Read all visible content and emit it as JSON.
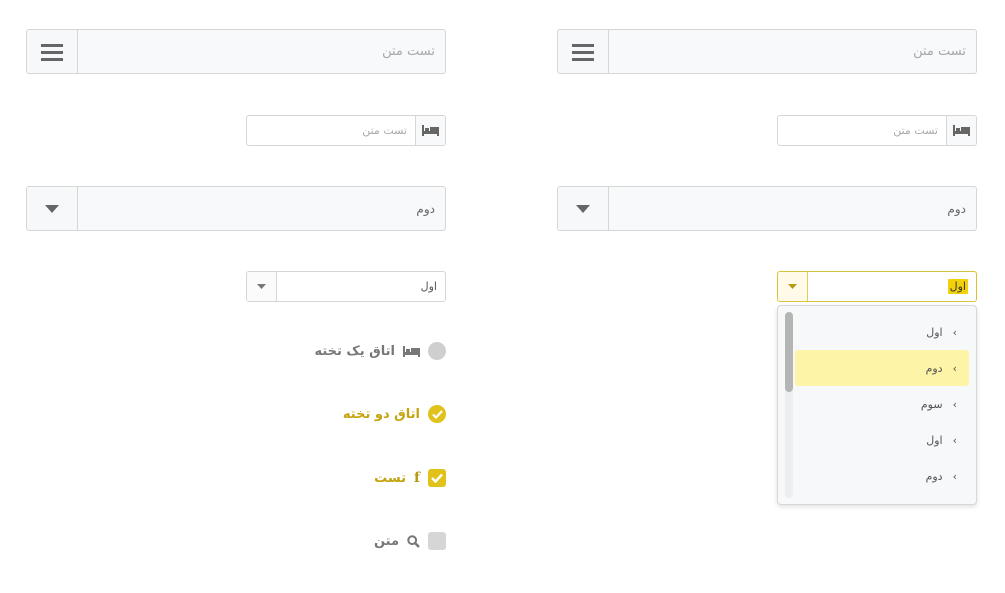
{
  "left_column": {
    "menu_field": {
      "placeholder": "تست متن"
    },
    "icon_field": {
      "placeholder": "تست متن"
    },
    "select_large": {
      "value": "دوم"
    },
    "select_small": {
      "value": "اول"
    },
    "options": [
      {
        "type": "radio",
        "state": "off",
        "icon": "bed-icon",
        "label": "اتاق یک تخته"
      },
      {
        "type": "radio",
        "state": "on",
        "icon": null,
        "label": "اتاق دو تخته"
      },
      {
        "type": "checkbox",
        "state": "on",
        "icon": "facebook-icon",
        "label": "تست"
      },
      {
        "type": "checkbox",
        "state": "off",
        "icon": "search-icon",
        "label": "متن"
      }
    ]
  },
  "right_column": {
    "menu_field": {
      "placeholder": "تست متن"
    },
    "icon_field": {
      "placeholder": "تست متن"
    },
    "select_large": {
      "value": "دوم"
    },
    "select_open": {
      "value": "اول",
      "items": [
        {
          "label": "اول",
          "selected": false
        },
        {
          "label": "دوم",
          "selected": true
        },
        {
          "label": "سوم",
          "selected": false
        },
        {
          "label": "اول",
          "selected": false
        },
        {
          "label": "دوم",
          "selected": false
        }
      ]
    }
  },
  "colors": {
    "accent": "#e0c21a",
    "accent_text": "#c4a40e",
    "highlight_bg": "#fdf4a8",
    "border": "#d6d6d6"
  }
}
